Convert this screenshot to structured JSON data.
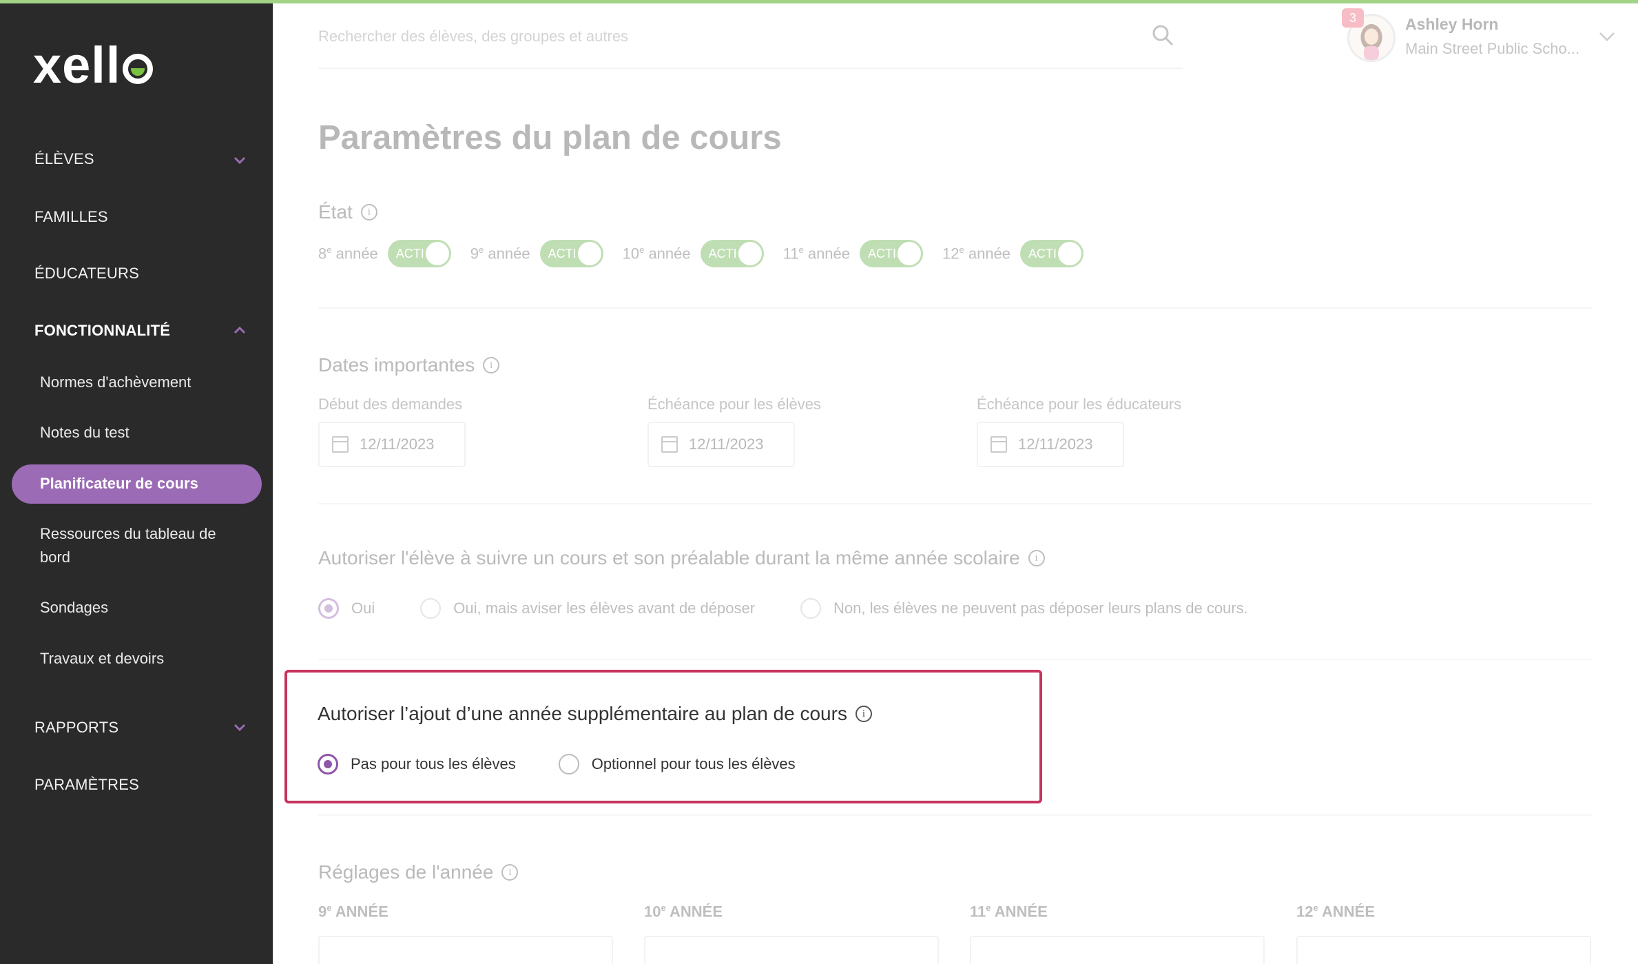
{
  "app": {
    "logo_text": "xell"
  },
  "sidebar": {
    "items": [
      {
        "label": "ÉLÈVES",
        "expandable": true
      },
      {
        "label": "FAMILLES"
      },
      {
        "label": "ÉDUCATEURS"
      },
      {
        "label": "FONCTIONNALITÉ",
        "expanded": true
      },
      {
        "label": "RAPPORTS",
        "expandable": true
      },
      {
        "label": "PARAMÈTRES"
      }
    ],
    "sub_items": [
      {
        "label": "Normes d'achèvement"
      },
      {
        "label": "Notes du test"
      },
      {
        "label": "Planificateur de cours",
        "active": true
      },
      {
        "label": "Ressources du tableau de bord"
      },
      {
        "label": "Sondages"
      },
      {
        "label": "Travaux et devoirs"
      }
    ]
  },
  "search": {
    "placeholder": "Rechercher des élèves, des groupes et autres"
  },
  "user": {
    "badge_count": "3",
    "name": "Ashley Horn",
    "school": "Main Street Public Scho..."
  },
  "page": {
    "title": "Paramètres du plan de cours"
  },
  "etat": {
    "title": "État",
    "toggle_text": "ACTI",
    "grades": [
      {
        "num": "8",
        "suffix": "e",
        "word": "année"
      },
      {
        "num": "9",
        "suffix": "e",
        "word": "année"
      },
      {
        "num": "10",
        "suffix": "e",
        "word": "année"
      },
      {
        "num": "11",
        "suffix": "e",
        "word": "année"
      },
      {
        "num": "12",
        "suffix": "e",
        "word": "année"
      }
    ]
  },
  "dates": {
    "title": "Dates importantes",
    "fields": [
      {
        "label": "Début des demandes",
        "value": "12/11/2023"
      },
      {
        "label": "Échéance pour les élèves",
        "value": "12/11/2023"
      },
      {
        "label": "Échéance pour les éducateurs",
        "value": "12/11/2023"
      }
    ]
  },
  "prerequisite": {
    "title": "Autoriser l'élève à suivre un cours et son préalable durant la même année scolaire",
    "options": [
      {
        "label": "Oui",
        "checked": true
      },
      {
        "label": "Oui, mais aviser les élèves avant de déposer",
        "checked": false
      },
      {
        "label": "Non, les élèves ne peuvent pas déposer leurs plans de cours.",
        "checked": false
      }
    ]
  },
  "extra_year": {
    "title": "Autoriser l’ajout d’une année supplémentaire au plan de cours",
    "options": [
      {
        "label": "Pas pour tous les élèves",
        "checked": true
      },
      {
        "label": "Optionnel pour tous les élèves",
        "checked": false
      }
    ]
  },
  "year_settings": {
    "title": "Réglages de l'année",
    "headers": [
      {
        "num": "9",
        "suffix": "e",
        "word": "ANNÉE"
      },
      {
        "num": "10",
        "suffix": "e",
        "word": "ANNÉE"
      },
      {
        "num": "11",
        "suffix": "e",
        "word": "ANNÉE"
      },
      {
        "num": "12",
        "suffix": "e",
        "word": "ANNÉE"
      }
    ]
  },
  "colors": {
    "sidebar_bg": "#2a2a2a",
    "accent_purple": "#9b6bb5",
    "toggle_green": "#5aa83a",
    "highlight_border": "#c7335d"
  }
}
